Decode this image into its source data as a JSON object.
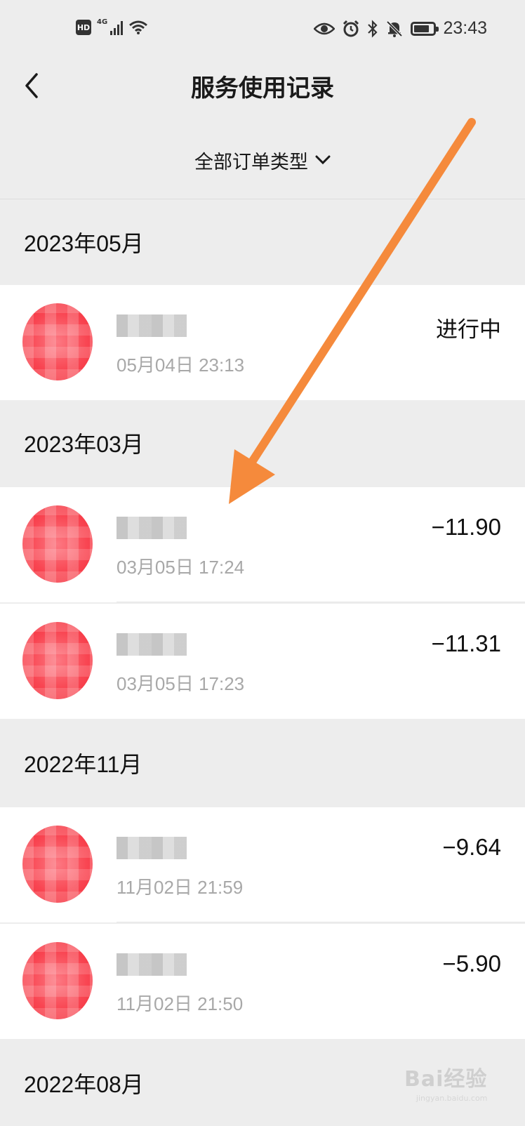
{
  "status_bar": {
    "hd": "HD",
    "network": "4G",
    "time": "23:43"
  },
  "header": {
    "title": "服务使用记录"
  },
  "filter": {
    "label": "全部订单类型"
  },
  "months": [
    {
      "label": "2023年05月",
      "records": [
        {
          "date": "05月04日 23:13",
          "amount": "进行中"
        }
      ]
    },
    {
      "label": "2023年03月",
      "records": [
        {
          "date": "03月05日 17:24",
          "amount": "−11.90"
        },
        {
          "date": "03月05日 17:23",
          "amount": "−11.31"
        }
      ]
    },
    {
      "label": "2022年11月",
      "records": [
        {
          "date": "11月02日 21:59",
          "amount": "−9.64"
        },
        {
          "date": "11月02日 21:50",
          "amount": "−5.90"
        }
      ]
    },
    {
      "label": "2022年08月",
      "records": []
    }
  ],
  "watermark": {
    "text": "Bai经验",
    "sub": "jingyan.baidu.com"
  },
  "colors": {
    "annotation_arrow": "#f58a3c",
    "avatar_red": "#ec4a55"
  }
}
